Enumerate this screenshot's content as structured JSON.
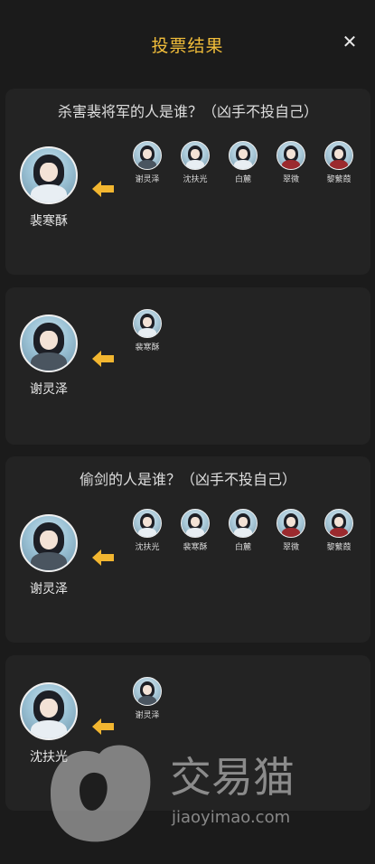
{
  "header": {
    "title": "投票结果",
    "close_icon": "close-icon"
  },
  "colors": {
    "accent": "#f1bd3a",
    "background": "#1b1b1b",
    "card": "#232323"
  },
  "sections": [
    {
      "question": "杀害裴将军的人是谁？（凶手不投自己）",
      "target": "裴寒酥",
      "voters": [
        "谢灵泽",
        "沈扶光",
        "白麓",
        "翠微",
        "黎蘩葭"
      ]
    },
    {
      "question": "",
      "target": "谢灵泽",
      "voters": [
        "裴寒酥"
      ]
    },
    {
      "question": "偷剑的人是谁？（凶手不投自己）",
      "target": "谢灵泽",
      "voters": [
        "沈扶光",
        "裴寒酥",
        "白麓",
        "翠微",
        "黎蘩葭"
      ]
    },
    {
      "question": "",
      "target": "沈扶光",
      "voters": [
        "谢灵泽"
      ]
    }
  ],
  "watermark": {
    "brand": "交易猫",
    "url": "jiaoyimao.com"
  }
}
